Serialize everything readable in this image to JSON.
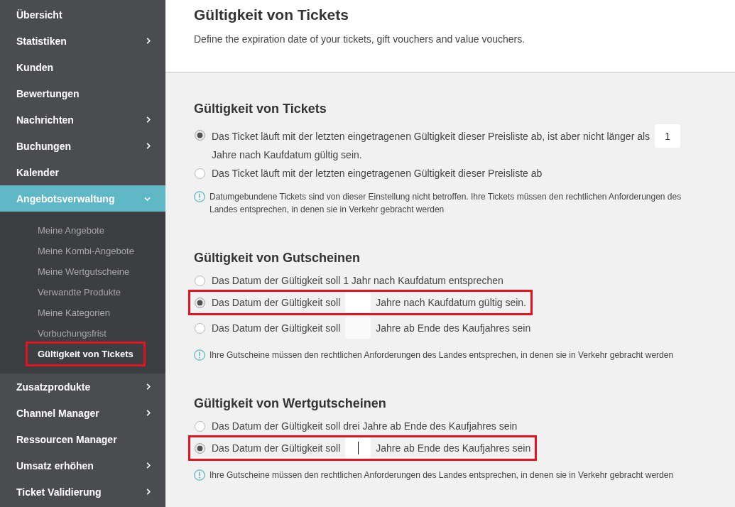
{
  "sidebar": {
    "items": [
      {
        "label": "Übersicht",
        "kind": "link",
        "selected": false
      },
      {
        "label": "Statistiken",
        "kind": "group",
        "selected": false,
        "expanded": false
      },
      {
        "label": "Kunden",
        "kind": "link",
        "selected": false
      },
      {
        "label": "Bewertungen",
        "kind": "link",
        "selected": false
      },
      {
        "label": "Nachrichten",
        "kind": "group",
        "selected": false,
        "expanded": false
      },
      {
        "label": "Buchungen",
        "kind": "group",
        "selected": false,
        "expanded": false
      },
      {
        "label": "Kalender",
        "kind": "link",
        "selected": false
      },
      {
        "label": "Angebotsverwaltung",
        "kind": "group",
        "selected": true,
        "expanded": true,
        "children": [
          {
            "label": "Meine Angebote",
            "selected": false,
            "highlighted": false
          },
          {
            "label": "Meine Kombi-Angebote",
            "selected": false,
            "highlighted": false
          },
          {
            "label": "Meine Wertgutscheine",
            "selected": false,
            "highlighted": false
          },
          {
            "label": "Verwandte Produkte",
            "selected": false,
            "highlighted": false
          },
          {
            "label": "Meine Kategorien",
            "selected": false,
            "highlighted": false
          },
          {
            "label": "Vorbuchungsfrist",
            "selected": false,
            "highlighted": false
          },
          {
            "label": "Gültigkeit von Tickets",
            "selected": true,
            "highlighted": true
          }
        ]
      },
      {
        "label": "Zusatzprodukte",
        "kind": "group",
        "selected": false,
        "expanded": false
      },
      {
        "label": "Channel Manager",
        "kind": "group",
        "selected": false,
        "expanded": false
      },
      {
        "label": "Ressourcen Manager",
        "kind": "link",
        "selected": false
      },
      {
        "label": "Umsatz erhöhen",
        "kind": "group",
        "selected": false,
        "expanded": false
      },
      {
        "label": "Ticket Validierung",
        "kind": "group",
        "selected": false,
        "expanded": false
      }
    ]
  },
  "header": {
    "title": "Gültigkeit von Tickets",
    "subtitle": "Define the expiration date of your tickets, gift vouchers and value vouchers."
  },
  "sections": [
    {
      "title": "Gültigkeit von Tickets",
      "options": [
        {
          "kind": "with_field",
          "selected": true,
          "highlighted": false,
          "text": "Das Ticket läuft mit der letzten eingetragenen Gültigkeit dieser Preisliste ab, ist aber nicht länger als",
          "field": {
            "value": "1",
            "focused": false
          },
          "text_after": "Jahre nach Kaufdatum gültig sein."
        },
        {
          "kind": "plain",
          "selected": false,
          "highlighted": false,
          "text": "Das Ticket läuft mit der letzten eingetragenen Gültigkeit dieser Preisliste ab"
        }
      ],
      "note": "Datumgebundene Tickets sind von dieser Einstellung nicht betroffen. Ihre Tickets müssen den rechtlichen Anforderungen des Landes entsprechen, in denen sie in Verkehr gebracht werden"
    },
    {
      "title": "Gültigkeit von Gutscheinen",
      "options": [
        {
          "kind": "plain",
          "selected": false,
          "highlighted": false,
          "text": "Das Datum der Gültigkeit soll 1 Jahr nach Kaufdatum entsprechen"
        },
        {
          "kind": "with_field",
          "selected": true,
          "highlighted": true,
          "text": "Das Datum der Gültigkeit soll",
          "field": {
            "focused": false
          },
          "text_after": "Jahre nach Kaufdatum gültig sein."
        },
        {
          "kind": "with_field",
          "selected": false,
          "highlighted": false,
          "text": "Das Datum der Gültigkeit soll",
          "field": {
            "focused": false
          },
          "text_after": "Jahre ab Ende des Kaufjahres sein"
        }
      ],
      "note": "Ihre Gutscheine müssen den rechtlichen Anforderungen des Landes entsprechen, in denen sie in Verkehr gebracht werden"
    },
    {
      "title": "Gültigkeit von Wertgutscheinen",
      "options": [
        {
          "kind": "plain",
          "selected": false,
          "highlighted": false,
          "text": "Das Datum der Gültigkeit soll drei Jahre ab Ende des Kaufjahres sein"
        },
        {
          "kind": "with_field",
          "selected": true,
          "highlighted": true,
          "text": "Das Datum der Gültigkeit soll",
          "field": {
            "focused": true
          },
          "text_after": "Jahre ab Ende des Kaufjahres sein"
        }
      ],
      "note": "Ihre Gutscheine müssen den rechtlichen Anforderungen des Landes entsprechen, in denen sie in Verkehr gebracht werden"
    }
  ]
}
